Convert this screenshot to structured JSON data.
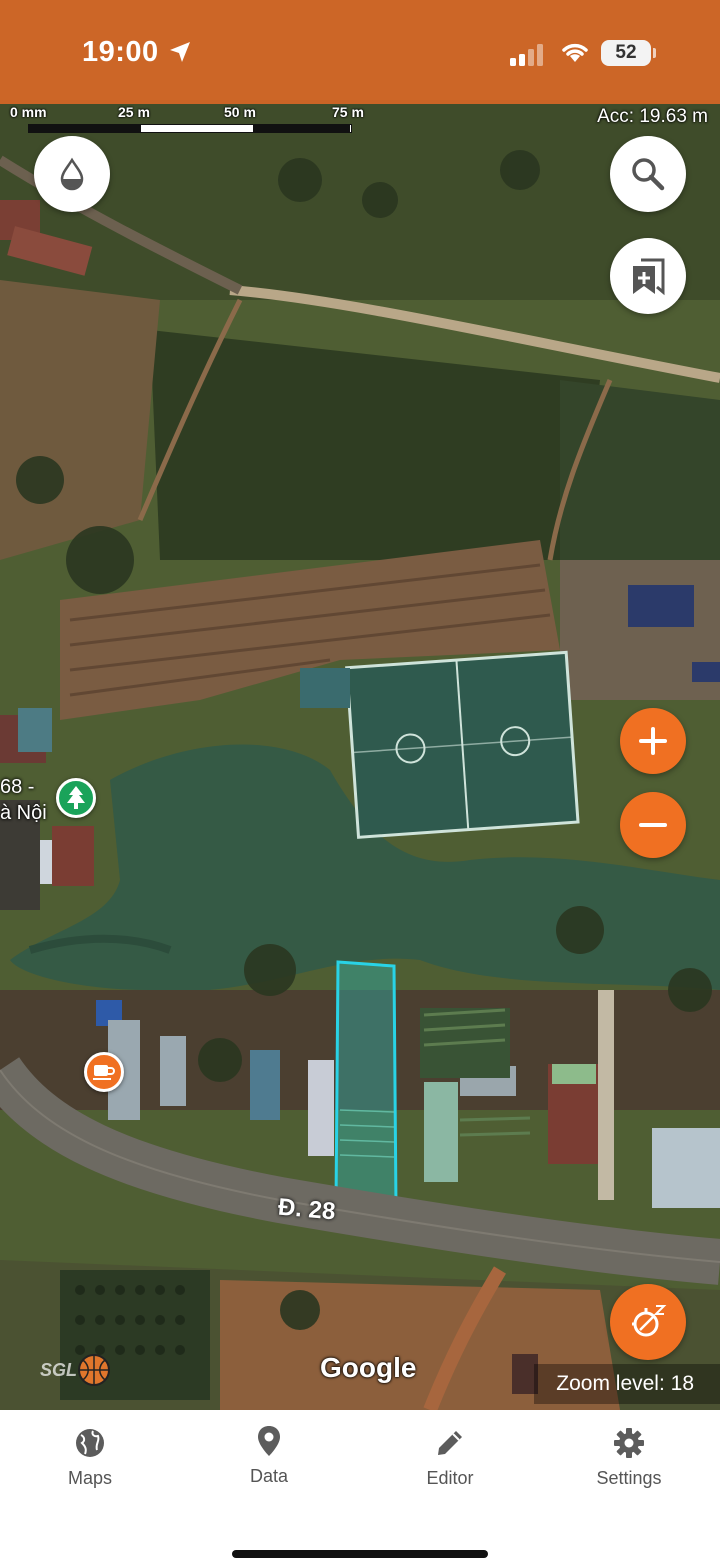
{
  "status_bar": {
    "time": "19:00",
    "battery": "52"
  },
  "map": {
    "scale_labels": [
      "0 mm",
      "25 m",
      "50 m",
      "75 m"
    ],
    "accuracy": "Acc: 19.63 m",
    "road_label": "Đ. 28",
    "poi_partial_label": [
      "68 -",
      "à Nội"
    ],
    "attribution": "Google",
    "watermark": "SGL",
    "zoom_level": "Zoom level: 18"
  },
  "bottom_nav": {
    "items": [
      {
        "label": "Maps",
        "icon": "globe-icon"
      },
      {
        "label": "Data",
        "icon": "location-pin-icon"
      },
      {
        "label": "Editor",
        "icon": "pencil-icon"
      },
      {
        "label": "Settings",
        "icon": "gear-icon"
      }
    ]
  },
  "colors": {
    "accent": "#f07022",
    "status_bar": "#de6826",
    "selection_outline": "#29d3e6"
  }
}
